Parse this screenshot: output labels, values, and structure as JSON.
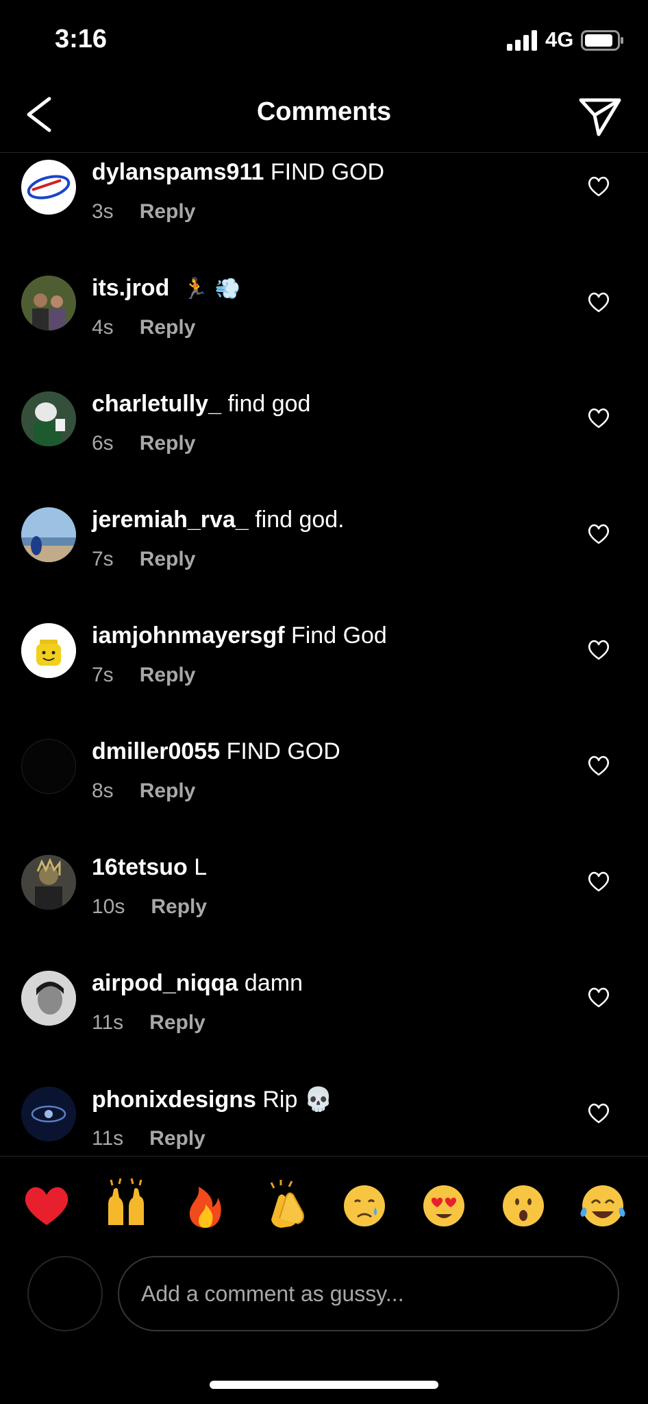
{
  "status": {
    "time": "3:16",
    "network": "4G"
  },
  "header": {
    "title": "Comments"
  },
  "comments": [
    {
      "username": "dylanspams911",
      "text": "FIND GOD",
      "age": "3s",
      "reply": "Reply",
      "avatar": "bills-logo"
    },
    {
      "username": "its.jrod",
      "text": "🏃 💨",
      "age": "4s",
      "reply": "Reply",
      "avatar": "couple-photo"
    },
    {
      "username": "charletully_",
      "text": "find god",
      "age": "6s",
      "reply": "Reply",
      "avatar": "football-player"
    },
    {
      "username": "jeremiah_rva_",
      "text": "find god.",
      "age": "7s",
      "reply": "Reply",
      "avatar": "beach-photo"
    },
    {
      "username": "iamjohnmayersgf",
      "text": "Find God",
      "age": "7s",
      "reply": "Reply",
      "avatar": "lego-head"
    },
    {
      "username": "dmiller0055",
      "text": "FIND GOD",
      "age": "8s",
      "reply": "Reply",
      "avatar": "dark"
    },
    {
      "username": "16tetsuo",
      "text": "L",
      "age": "10s",
      "reply": "Reply",
      "avatar": "portrait"
    },
    {
      "username": "airpod_niqqa",
      "text": "damn",
      "age": "11s",
      "reply": "Reply",
      "avatar": "bw-portrait"
    },
    {
      "username": "phonixdesigns",
      "text": "Rip 💀",
      "age": "11s",
      "reply": "Reply",
      "avatar": "blue-eye"
    }
  ],
  "reactions": [
    "heart",
    "raised-hands",
    "fire",
    "clapping-hands",
    "crying-face",
    "heart-eyes",
    "surprised-face",
    "tears-of-joy"
  ],
  "composer": {
    "placeholder": "Add a comment as gussy..."
  },
  "icons": {
    "back": "chevron-left-icon",
    "share": "paper-plane-icon",
    "like": "heart-outline-icon"
  }
}
